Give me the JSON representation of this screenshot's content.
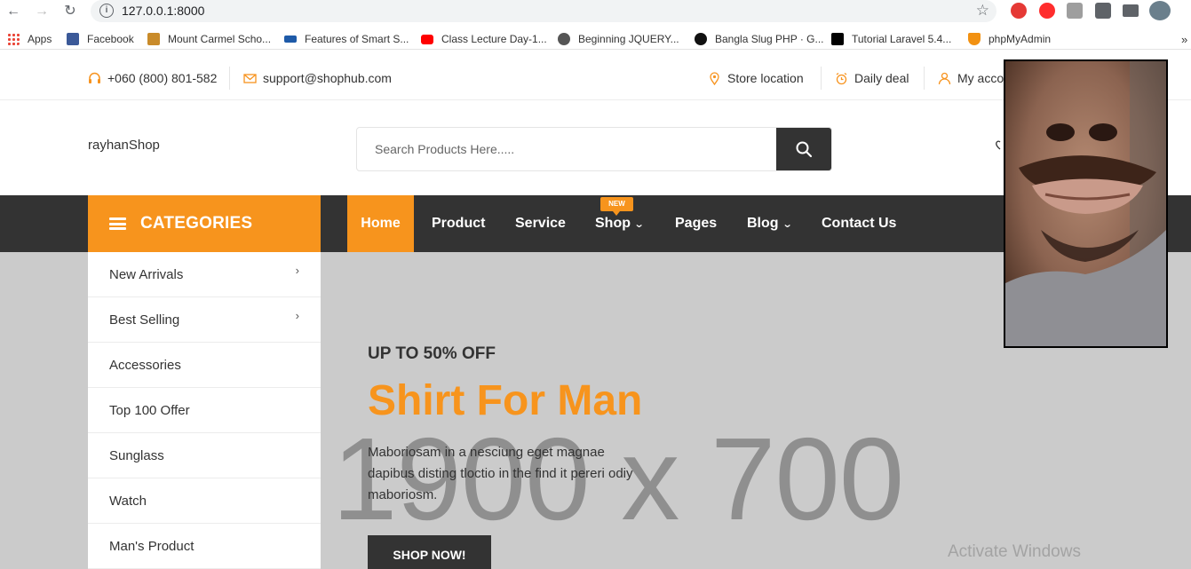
{
  "browser": {
    "url": "127.0.0.1:8000",
    "bookmarks": [
      {
        "label": "Apps",
        "color": "#4285f4"
      },
      {
        "label": "Facebook",
        "color": "#3b5998"
      },
      {
        "label": "Mount Carmel Scho...",
        "color": "#c98b2a"
      },
      {
        "label": "Features of Smart S...",
        "color": "#1e5aa8"
      },
      {
        "label": "Class Lecture Day-1...",
        "color": "#ff0000"
      },
      {
        "label": "Beginning JQUERY...",
        "color": "#555555"
      },
      {
        "label": "Bangla Slug PHP · G...",
        "color": "#111111"
      },
      {
        "label": "Tutorial Laravel 5.4...",
        "color": "#000000"
      },
      {
        "label": "phpMyAdmin",
        "color": "#f29111"
      }
    ],
    "more_bookmarks": "»"
  },
  "topbar": {
    "phone": "+060 (800) 801-582",
    "email": "support@shophub.com",
    "store_location": "Store location",
    "daily_deal": "Daily deal",
    "my_account": "My acco"
  },
  "header": {
    "logo": "rayhanShop",
    "search_placeholder": "Search Products Here....."
  },
  "nav": {
    "categories_label": "CATEGORIES",
    "items": [
      {
        "label": "Home",
        "active": true
      },
      {
        "label": "Product"
      },
      {
        "label": "Service"
      },
      {
        "label": "Shop",
        "badge": "NEW",
        "dropdown": true
      },
      {
        "label": "Pages"
      },
      {
        "label": "Blog",
        "dropdown": true
      },
      {
        "label": "Contact Us"
      }
    ]
  },
  "categories": [
    {
      "label": "New Arrivals",
      "has_submenu": true
    },
    {
      "label": "Best Selling",
      "has_submenu": true
    },
    {
      "label": "Accessories"
    },
    {
      "label": "Top 100 Offer"
    },
    {
      "label": "Sunglass"
    },
    {
      "label": "Watch"
    },
    {
      "label": "Man's Product"
    }
  ],
  "hero": {
    "placeholder": "1900 x 700",
    "kicker": "UP TO 50% OFF",
    "title": "Shirt For Man",
    "description": "Maboriosam in a nesciung eget magnae dapibus disting tloctio in the find it pereri odiy maboriosm.",
    "button": "SHOP NOW!"
  },
  "watermark": "Activate Windows",
  "colors": {
    "accent": "#f7941d",
    "dark": "#333333",
    "hero_bg": "#cbcbcb"
  }
}
